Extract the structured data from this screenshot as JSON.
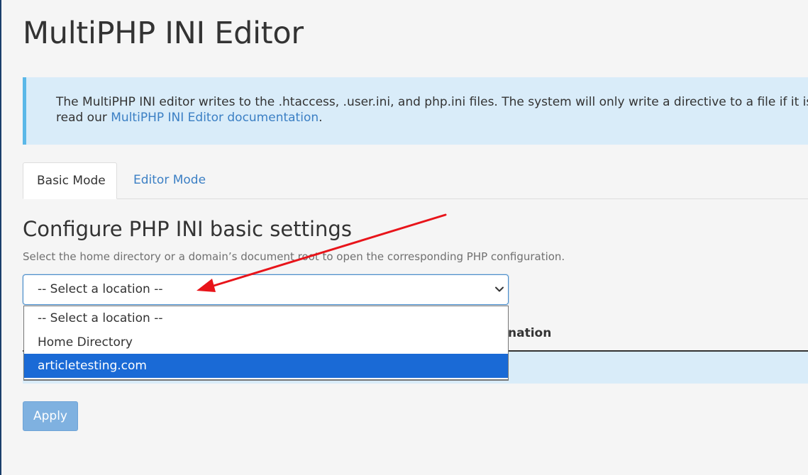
{
  "page": {
    "title": "MultiPHP INI Editor"
  },
  "info_box": {
    "text": "The MultiPHP INI editor writes to the .htaccess, .user.ini, and php.ini files. The system will only write a directive to a file if it is a valid",
    "text_line2_prefix": "read our",
    "link_text": "MultiPHP INI Editor documentation",
    "text_line2_suffix": "."
  },
  "tabs": [
    {
      "label": "Basic Mode",
      "active": true
    },
    {
      "label": "Editor Mode",
      "active": false
    }
  ],
  "section": {
    "title": "Configure PHP INI basic settings",
    "description": "Select the home directory or a domain’s document root to open the corresponding PHP configuration."
  },
  "location_select": {
    "selected": "-- Select a location --",
    "icon": "chevron-down-icon",
    "options": [
      {
        "label": "-- Select a location --",
        "highlighted": false
      },
      {
        "label": "Home Directory",
        "highlighted": false
      },
      {
        "label": "articletesting.com",
        "highlighted": true
      }
    ]
  },
  "table": {
    "header_partial": "nation"
  },
  "apply_button": {
    "label": "Apply",
    "disabled": true
  },
  "colors": {
    "link": "#3b7fc4",
    "info_background": "#d9ecf9",
    "info_border": "#5bb8e8",
    "highlight": "#1a6ad6",
    "apply_button": "#7fb1e0",
    "annotation_arrow": "#e8141a"
  }
}
